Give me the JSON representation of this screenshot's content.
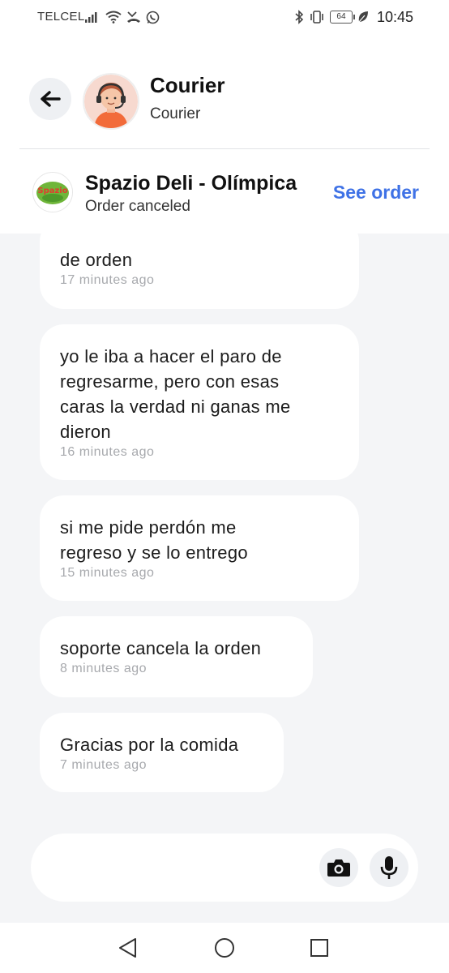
{
  "status_bar": {
    "carrier": "TELCEL",
    "time": "10:45",
    "battery": "64",
    "icons_left": [
      "signal-icon",
      "wifi-icon",
      "missed-call-icon",
      "whatsapp-icon"
    ],
    "icons_right": [
      "bluetooth-icon",
      "vibrate-icon",
      "battery-icon",
      "leaf-icon"
    ]
  },
  "header": {
    "title": "Courier",
    "subtitle": "Courier",
    "back_icon": "arrow-left-icon",
    "avatar": "courier-avatar"
  },
  "order": {
    "store_name": "Spazio Deli - Olímpica",
    "status": "Order canceled",
    "action_label": "See order",
    "logo_text": "Spazio",
    "accent_color": "#3f72e6"
  },
  "messages": [
    {
      "lines": [
        "de orden"
      ],
      "time": "17 minutes ago"
    },
    {
      "lines": [
        "yo le iba a hacer el paro de",
        "regresarme, pero con esas",
        "caras la verdad ni ganas me",
        "dieron"
      ],
      "time": "16 minutes ago"
    },
    {
      "lines": [
        "si me pide perdón me",
        "regreso y se lo entrego"
      ],
      "time": "15 minutes ago"
    },
    {
      "lines": [
        "soporte cancela la orden"
      ],
      "time": "8 minutes ago"
    },
    {
      "lines": [
        "Gracias por la comida"
      ],
      "time": "7 minutes ago"
    }
  ],
  "composer": {
    "camera_icon": "camera-icon",
    "mic_icon": "microphone-icon"
  },
  "navbar": {
    "icons": [
      "back-triangle-icon",
      "home-circle-icon",
      "recents-square-icon"
    ]
  }
}
